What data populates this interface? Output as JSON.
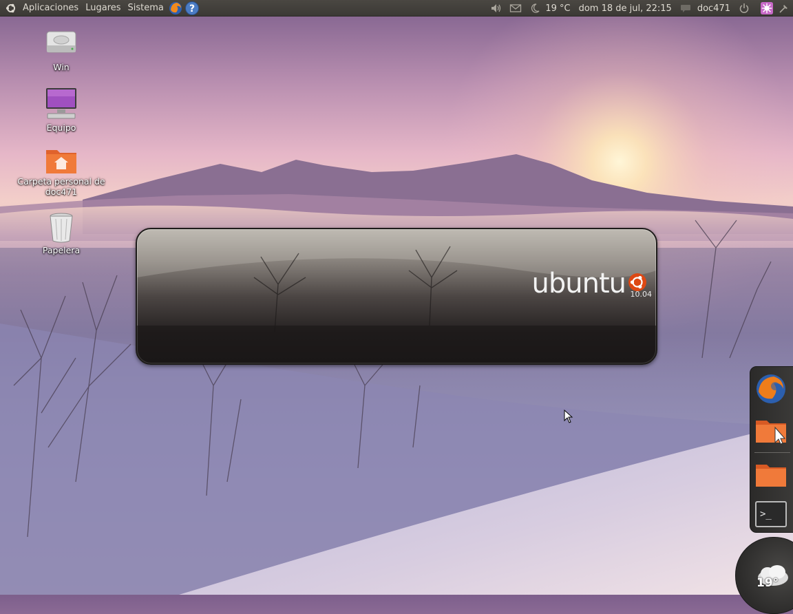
{
  "top_panel": {
    "menus": [
      "Aplicaciones",
      "Lugares",
      "Sistema"
    ],
    "temperature": "19 °C",
    "datetime": "dom 18 de jul, 22:15",
    "username": "doc471"
  },
  "desktop_icons": [
    {
      "label": "Win",
      "icon": "hard-drive-icon"
    },
    {
      "label": "Equipo",
      "icon": "computer-icon"
    },
    {
      "label": "Carpeta personal de doc471",
      "icon": "home-folder-icon"
    },
    {
      "label": "Papelera",
      "icon": "trash-icon"
    }
  ],
  "splash": {
    "brand": "ubuntu",
    "version": "10.04"
  },
  "dock": {
    "items": [
      "firefox-icon",
      "folder-icon",
      "folder-icon",
      "terminal-icon"
    ],
    "weather_temp": "19°"
  },
  "colors": {
    "panel_bg": "#3b3935",
    "ubuntu_orange": "#dd4814"
  }
}
